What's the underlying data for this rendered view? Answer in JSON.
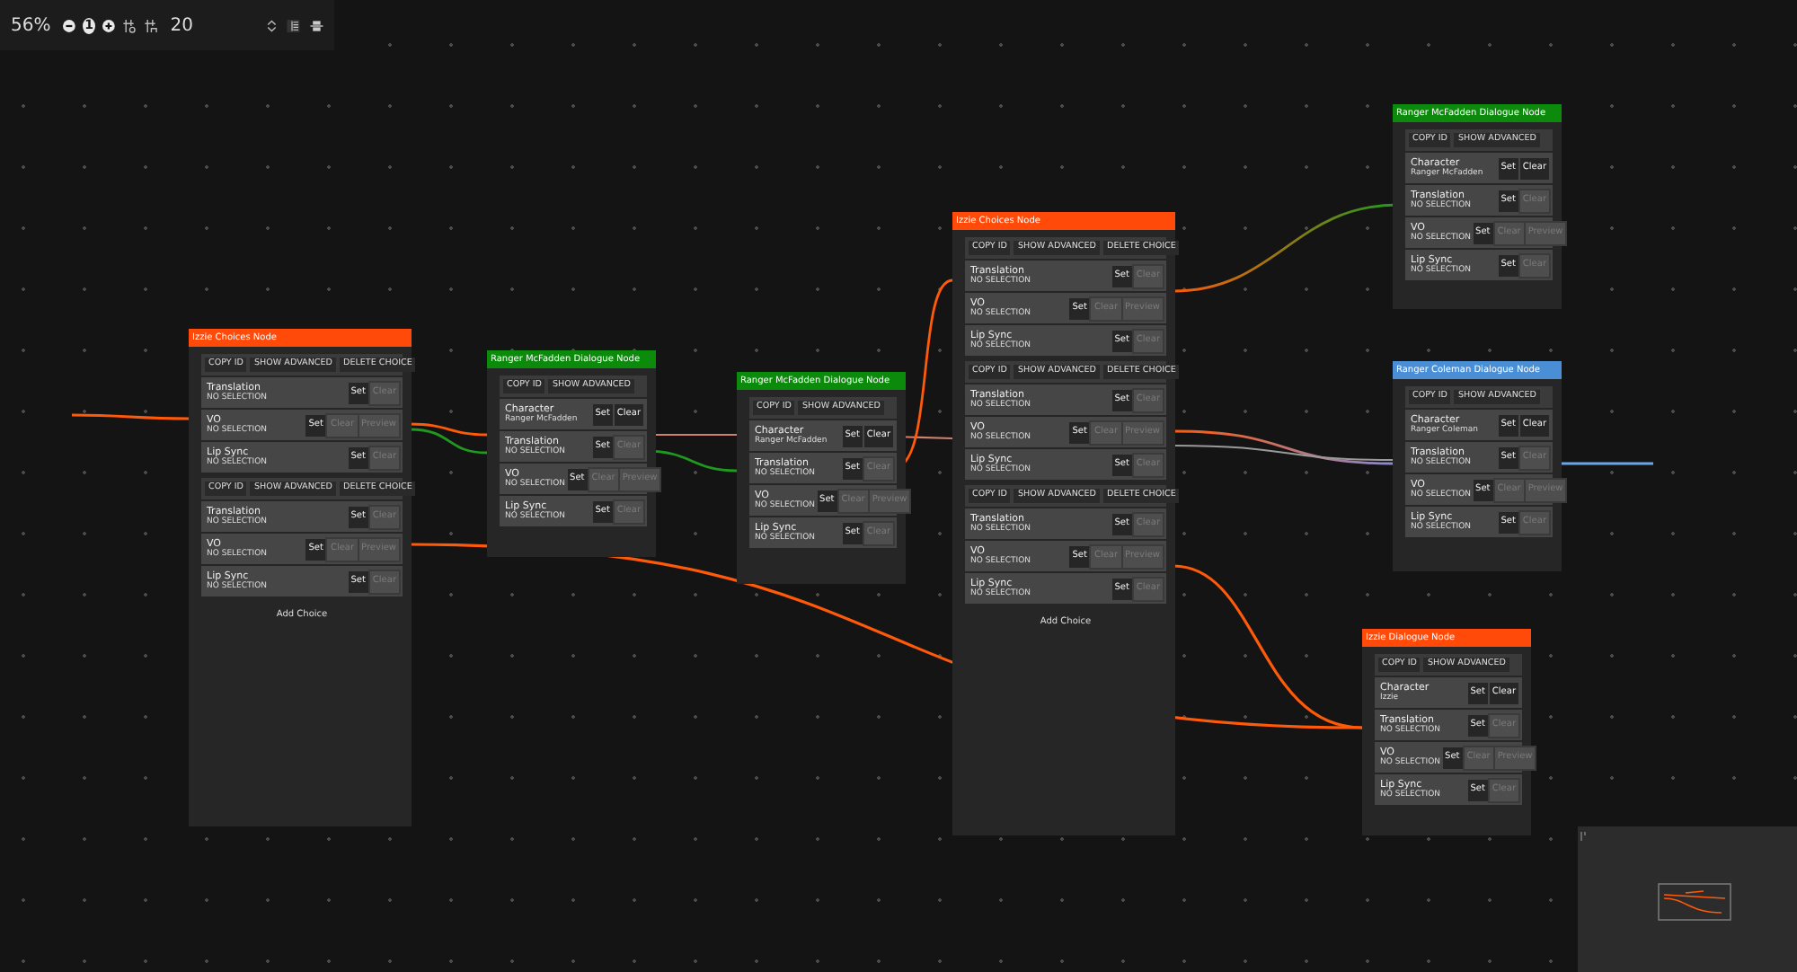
{
  "toolbar": {
    "zoom": "56%",
    "reset_zoom": "1",
    "grid_size": "20"
  },
  "nodes": [
    {
      "kind": "choices",
      "title": "Izzie Choices Node",
      "color": "#ff4a0a",
      "choices": [
        {
          "actions": [
            "COPY ID",
            "SHOW ADVANCED",
            "DELETE CHOICE"
          ],
          "fields": [
            {
              "label": "Translation",
              "value": "NO SELECTION",
              "buttons": [
                {
                  "label": "Set",
                  "disabled": false
                },
                {
                  "label": "Clear",
                  "disabled": true
                }
              ]
            },
            {
              "label": "VO",
              "value": "NO SELECTION",
              "buttons": [
                {
                  "label": "Set",
                  "disabled": false
                },
                {
                  "label": "Clear",
                  "disabled": true
                },
                {
                  "label": "Preview",
                  "disabled": true
                }
              ]
            },
            {
              "label": "Lip Sync",
              "value": "NO SELECTION",
              "buttons": [
                {
                  "label": "Set",
                  "disabled": false
                },
                {
                  "label": "Clear",
                  "disabled": true
                }
              ]
            }
          ]
        },
        {
          "actions": [
            "COPY ID",
            "SHOW ADVANCED",
            "DELETE CHOICE"
          ],
          "fields": [
            {
              "label": "Translation",
              "value": "NO SELECTION",
              "buttons": [
                {
                  "label": "Set",
                  "disabled": false
                },
                {
                  "label": "Clear",
                  "disabled": true
                }
              ]
            },
            {
              "label": "VO",
              "value": "NO SELECTION",
              "buttons": [
                {
                  "label": "Set",
                  "disabled": false
                },
                {
                  "label": "Clear",
                  "disabled": true
                },
                {
                  "label": "Preview",
                  "disabled": true
                }
              ]
            },
            {
              "label": "Lip Sync",
              "value": "NO SELECTION",
              "buttons": [
                {
                  "label": "Set",
                  "disabled": false
                },
                {
                  "label": "Clear",
                  "disabled": true
                }
              ]
            }
          ]
        }
      ],
      "add_label": "Add Choice"
    },
    {
      "kind": "dialogue",
      "title": "Ranger McFadden Dialogue Node",
      "color": "#0c8a0c",
      "actions": [
        "COPY ID",
        "SHOW ADVANCED"
      ],
      "fields": [
        {
          "label": "Character",
          "value": "Ranger McFadden",
          "buttons": [
            {
              "label": "Set",
              "disabled": false
            },
            {
              "label": "Clear",
              "disabled": false
            }
          ]
        },
        {
          "label": "Translation",
          "value": "NO SELECTION",
          "buttons": [
            {
              "label": "Set",
              "disabled": false
            },
            {
              "label": "Clear",
              "disabled": true
            }
          ]
        },
        {
          "label": "VO",
          "value": "NO SELECTION",
          "buttons": [
            {
              "label": "Set",
              "disabled": false
            },
            {
              "label": "Clear",
              "disabled": true
            },
            {
              "label": "Preview",
              "disabled": true
            }
          ]
        },
        {
          "label": "Lip Sync",
          "value": "NO SELECTION",
          "buttons": [
            {
              "label": "Set",
              "disabled": false
            },
            {
              "label": "Clear",
              "disabled": true
            }
          ]
        }
      ]
    },
    {
      "kind": "dialogue",
      "title": "Ranger McFadden Dialogue Node",
      "color": "#0c8a0c",
      "actions": [
        "COPY ID",
        "SHOW ADVANCED"
      ],
      "fields": [
        {
          "label": "Character",
          "value": "Ranger McFadden",
          "buttons": [
            {
              "label": "Set",
              "disabled": false
            },
            {
              "label": "Clear",
              "disabled": false
            }
          ]
        },
        {
          "label": "Translation",
          "value": "NO SELECTION",
          "buttons": [
            {
              "label": "Set",
              "disabled": false
            },
            {
              "label": "Clear",
              "disabled": true
            }
          ]
        },
        {
          "label": "VO",
          "value": "NO SELECTION",
          "buttons": [
            {
              "label": "Set",
              "disabled": false
            },
            {
              "label": "Clear",
              "disabled": true
            },
            {
              "label": "Preview",
              "disabled": true
            }
          ]
        },
        {
          "label": "Lip Sync",
          "value": "NO SELECTION",
          "buttons": [
            {
              "label": "Set",
              "disabled": false
            },
            {
              "label": "Clear",
              "disabled": true
            }
          ]
        }
      ]
    },
    {
      "kind": "choices",
      "title": "Izzie Choices Node",
      "color": "#ff4a0a",
      "choices": [
        {
          "actions": [
            "COPY ID",
            "SHOW ADVANCED",
            "DELETE CHOICE"
          ],
          "fields": [
            {
              "label": "Translation",
              "value": "NO SELECTION",
              "buttons": [
                {
                  "label": "Set",
                  "disabled": false
                },
                {
                  "label": "Clear",
                  "disabled": true
                }
              ]
            },
            {
              "label": "VO",
              "value": "NO SELECTION",
              "buttons": [
                {
                  "label": "Set",
                  "disabled": false
                },
                {
                  "label": "Clear",
                  "disabled": true
                },
                {
                  "label": "Preview",
                  "disabled": true
                }
              ]
            },
            {
              "label": "Lip Sync",
              "value": "NO SELECTION",
              "buttons": [
                {
                  "label": "Set",
                  "disabled": false
                },
                {
                  "label": "Clear",
                  "disabled": true
                }
              ]
            }
          ]
        },
        {
          "actions": [
            "COPY ID",
            "SHOW ADVANCED",
            "DELETE CHOICE"
          ],
          "fields": [
            {
              "label": "Translation",
              "value": "NO SELECTION",
              "buttons": [
                {
                  "label": "Set",
                  "disabled": false
                },
                {
                  "label": "Clear",
                  "disabled": true
                }
              ]
            },
            {
              "label": "VO",
              "value": "NO SELECTION",
              "buttons": [
                {
                  "label": "Set",
                  "disabled": false
                },
                {
                  "label": "Clear",
                  "disabled": true
                },
                {
                  "label": "Preview",
                  "disabled": true
                }
              ]
            },
            {
              "label": "Lip Sync",
              "value": "NO SELECTION",
              "buttons": [
                {
                  "label": "Set",
                  "disabled": false
                },
                {
                  "label": "Clear",
                  "disabled": true
                }
              ]
            }
          ]
        },
        {
          "actions": [
            "COPY ID",
            "SHOW ADVANCED",
            "DELETE CHOICE"
          ],
          "fields": [
            {
              "label": "Translation",
              "value": "NO SELECTION",
              "buttons": [
                {
                  "label": "Set",
                  "disabled": false
                },
                {
                  "label": "Clear",
                  "disabled": true
                }
              ]
            },
            {
              "label": "VO",
              "value": "NO SELECTION",
              "buttons": [
                {
                  "label": "Set",
                  "disabled": false
                },
                {
                  "label": "Clear",
                  "disabled": true
                },
                {
                  "label": "Preview",
                  "disabled": true
                }
              ]
            },
            {
              "label": "Lip Sync",
              "value": "NO SELECTION",
              "buttons": [
                {
                  "label": "Set",
                  "disabled": false
                },
                {
                  "label": "Clear",
                  "disabled": true
                }
              ]
            }
          ]
        }
      ],
      "add_label": "Add Choice"
    },
    {
      "kind": "dialogue",
      "title": "Ranger McFadden Dialogue Node",
      "color": "#0c8a0c",
      "actions": [
        "COPY ID",
        "SHOW ADVANCED"
      ],
      "fields": [
        {
          "label": "Character",
          "value": "Ranger McFadden",
          "buttons": [
            {
              "label": "Set",
              "disabled": false
            },
            {
              "label": "Clear",
              "disabled": false
            }
          ]
        },
        {
          "label": "Translation",
          "value": "NO SELECTION",
          "buttons": [
            {
              "label": "Set",
              "disabled": false
            },
            {
              "label": "Clear",
              "disabled": true
            }
          ]
        },
        {
          "label": "VO",
          "value": "NO SELECTION",
          "buttons": [
            {
              "label": "Set",
              "disabled": false
            },
            {
              "label": "Clear",
              "disabled": true
            },
            {
              "label": "Preview",
              "disabled": true
            }
          ]
        },
        {
          "label": "Lip Sync",
          "value": "NO SELECTION",
          "buttons": [
            {
              "label": "Set",
              "disabled": false
            },
            {
              "label": "Clear",
              "disabled": true
            }
          ]
        }
      ]
    },
    {
      "kind": "dialogue",
      "title": "Ranger Coleman Dialogue Node",
      "color": "#4a8fd6",
      "actions": [
        "COPY ID",
        "SHOW ADVANCED"
      ],
      "fields": [
        {
          "label": "Character",
          "value": "Ranger Coleman",
          "buttons": [
            {
              "label": "Set",
              "disabled": false
            },
            {
              "label": "Clear",
              "disabled": false
            }
          ]
        },
        {
          "label": "Translation",
          "value": "NO SELECTION",
          "buttons": [
            {
              "label": "Set",
              "disabled": false
            },
            {
              "label": "Clear",
              "disabled": true
            }
          ]
        },
        {
          "label": "VO",
          "value": "NO SELECTION",
          "buttons": [
            {
              "label": "Set",
              "disabled": false
            },
            {
              "label": "Clear",
              "disabled": true
            },
            {
              "label": "Preview",
              "disabled": true
            }
          ]
        },
        {
          "label": "Lip Sync",
          "value": "NO SELECTION",
          "buttons": [
            {
              "label": "Set",
              "disabled": false
            },
            {
              "label": "Clear",
              "disabled": true
            }
          ]
        }
      ]
    },
    {
      "kind": "dialogue",
      "title": "Izzie Dialogue Node",
      "color": "#ff4a0a",
      "actions": [
        "COPY ID",
        "SHOW ADVANCED"
      ],
      "fields": [
        {
          "label": "Character",
          "value": "Izzie",
          "buttons": [
            {
              "label": "Set",
              "disabled": false
            },
            {
              "label": "Clear",
              "disabled": false
            }
          ]
        },
        {
          "label": "Translation",
          "value": "NO SELECTION",
          "buttons": [
            {
              "label": "Set",
              "disabled": false
            },
            {
              "label": "Clear",
              "disabled": true
            }
          ]
        },
        {
          "label": "VO",
          "value": "NO SELECTION",
          "buttons": [
            {
              "label": "Set",
              "disabled": false
            },
            {
              "label": "Clear",
              "disabled": true
            },
            {
              "label": "Preview",
              "disabled": true
            }
          ]
        },
        {
          "label": "Lip Sync",
          "value": "NO SELECTION",
          "buttons": [
            {
              "label": "Set",
              "disabled": false
            },
            {
              "label": "Clear",
              "disabled": true
            }
          ]
        }
      ]
    }
  ]
}
